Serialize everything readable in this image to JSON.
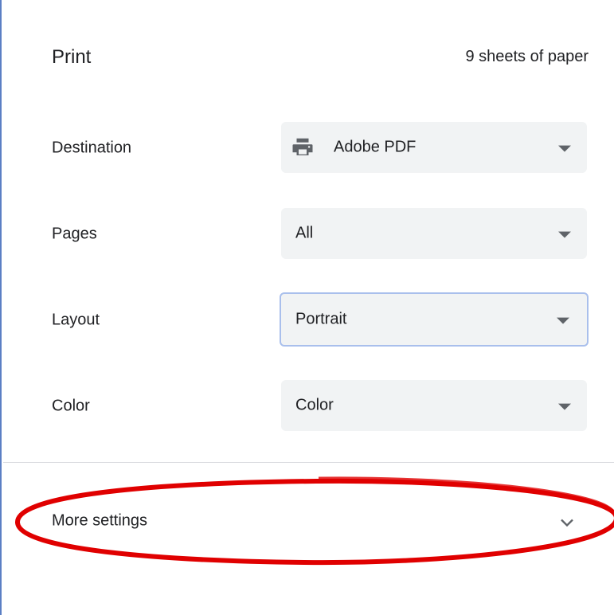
{
  "header": {
    "title": "Print",
    "summary": "9 sheets of paper"
  },
  "settings": [
    {
      "label": "Destination",
      "value": "Adobe PDF",
      "icon": "printer-icon"
    },
    {
      "label": "Pages",
      "value": "All"
    },
    {
      "label": "Layout",
      "value": "Portrait"
    },
    {
      "label": "Color",
      "value": "Color"
    }
  ],
  "more_settings": {
    "label": "More settings",
    "icon": "chevron-down-icon"
  },
  "colors": {
    "annotation": "#e00000",
    "focus_border": "#a9bfec",
    "select_bg": "#f1f3f4"
  }
}
